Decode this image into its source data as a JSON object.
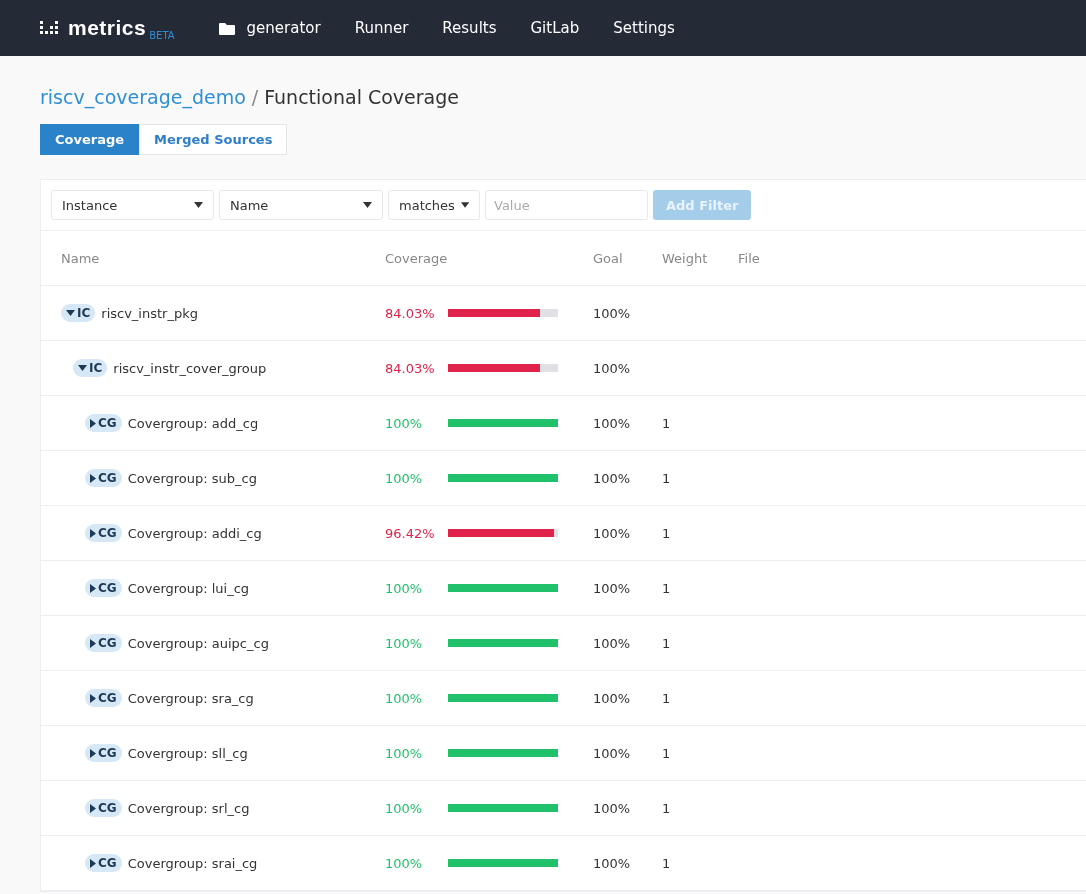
{
  "nav": {
    "logo": "metrics",
    "logo_badge": "BETA",
    "items": [
      {
        "label": "generator",
        "kind": "folder"
      },
      {
        "label": "Runner",
        "kind": "link"
      },
      {
        "label": "Results",
        "kind": "link"
      },
      {
        "label": "GitLab",
        "kind": "link"
      },
      {
        "label": "Settings",
        "kind": "link"
      }
    ]
  },
  "breadcrumb": {
    "project": "riscv_coverage_demo",
    "separator": "/",
    "page": "Functional Coverage"
  },
  "tabs": [
    {
      "label": "Coverage",
      "selected": true
    },
    {
      "label": "Merged Sources",
      "selected": false
    }
  ],
  "filter": {
    "field": "Instance",
    "attribute": "Name",
    "operator": "matches",
    "value_placeholder": "Value",
    "button": {
      "label": "Add Filter",
      "disabled": true
    }
  },
  "table": {
    "columns": [
      "Name",
      "Coverage",
      "Goal",
      "Weight",
      "File"
    ],
    "rows": [
      {
        "badge": "IC",
        "name": "riscv_instr_pkg",
        "coverage": "84.03%",
        "level": 0.8403,
        "color": "#e0234a",
        "goal": "100%",
        "expanded": true,
        "children": [
          {
            "badge": "IC",
            "name": "riscv_instr_cover_group",
            "coverage": "84.03%",
            "level": 0.8403,
            "color": "#e0234a",
            "goal": "100%",
            "expanded": true,
            "children": [
              {
                "badge": "CG",
                "name": "Covergroup: add_cg",
                "coverage": "100%",
                "level": 1,
                "color": "#21c16b",
                "goal": "100%",
                "weight": "1",
                "expanded": false
              },
              {
                "badge": "CG",
                "name": "Covergroup: sub_cg",
                "coverage": "100%",
                "level": 1,
                "color": "#21c16b",
                "goal": "100%",
                "weight": "1",
                "expanded": false
              },
              {
                "badge": "CG",
                "name": "Covergroup: addi_cg",
                "coverage": "96.42%",
                "level": 0.9642,
                "color": "#e0234a",
                "goal": "100%",
                "weight": "1",
                "expanded": false
              },
              {
                "badge": "CG",
                "name": "Covergroup: lui_cg",
                "coverage": "100%",
                "level": 1,
                "color": "#21c16b",
                "goal": "100%",
                "weight": "1",
                "expanded": false
              },
              {
                "badge": "CG",
                "name": "Covergroup: auipc_cg",
                "coverage": "100%",
                "level": 1,
                "color": "#21c16b",
                "goal": "100%",
                "weight": "1",
                "expanded": false
              },
              {
                "badge": "CG",
                "name": "Covergroup: sra_cg",
                "coverage": "100%",
                "level": 1,
                "color": "#21c16b",
                "goal": "100%",
                "weight": "1",
                "expanded": false
              },
              {
                "badge": "CG",
                "name": "Covergroup: sll_cg",
                "coverage": "100%",
                "level": 1,
                "color": "#21c16b",
                "goal": "100%",
                "weight": "1",
                "expanded": false
              },
              {
                "badge": "CG",
                "name": "Covergroup: srl_cg",
                "coverage": "100%",
                "level": 1,
                "color": "#21c16b",
                "goal": "100%",
                "weight": "1",
                "expanded": false
              },
              {
                "badge": "CG",
                "name": "Covergroup: srai_cg",
                "coverage": "100%",
                "level": 1,
                "color": "#21c16b",
                "goal": "100%",
                "weight": "1",
                "expanded": false
              }
            ]
          }
        ]
      }
    ]
  }
}
